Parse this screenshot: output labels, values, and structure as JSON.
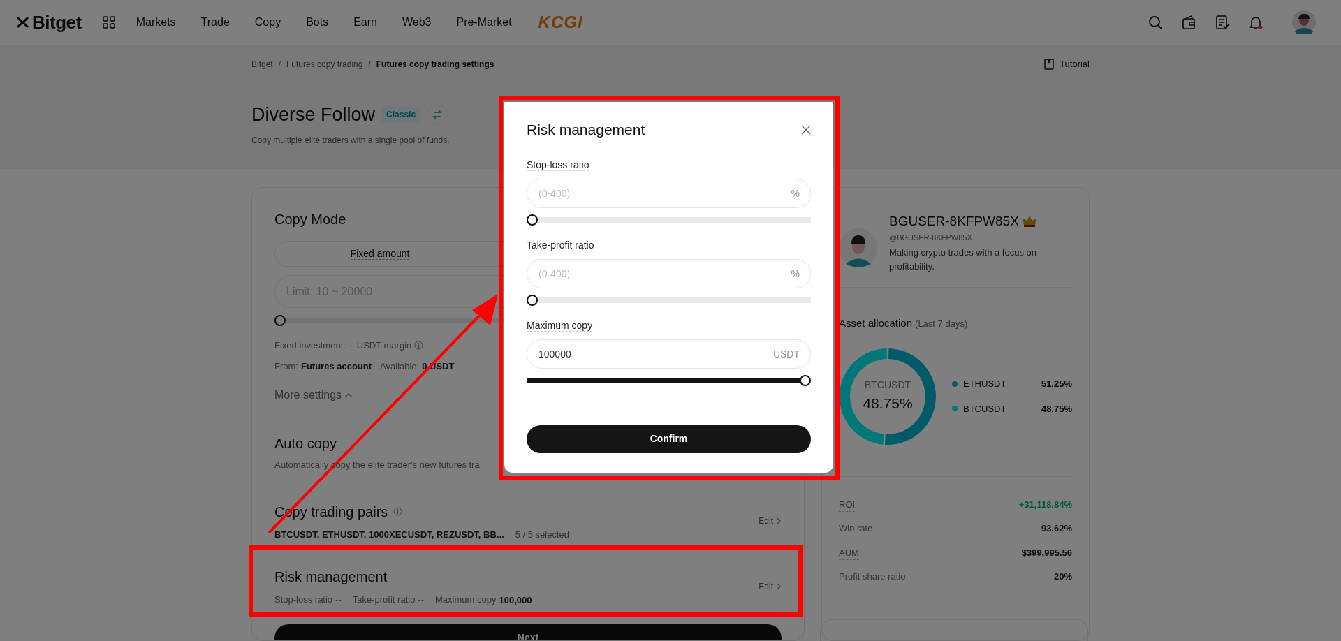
{
  "header": {
    "logo": "Bitget",
    "nav": [
      {
        "label": "Markets"
      },
      {
        "label": "Trade"
      },
      {
        "label": "Copy"
      },
      {
        "label": "Bots"
      },
      {
        "label": "Earn"
      },
      {
        "label": "Web3"
      },
      {
        "label": "Pre-Market"
      }
    ],
    "promo_logo": "KCGI",
    "notifications_unread": true
  },
  "breadcrumb": [
    {
      "label": "Bitget",
      "current": false
    },
    {
      "separator": "/",
      "label": "Futures copy trading",
      "current": false
    },
    {
      "separator": "/",
      "label": "Futures copy trading settings",
      "current": true
    }
  ],
  "tutorial": "Tutorial",
  "page": {
    "title": "Diverse Follow",
    "badge": "Classic",
    "subtitle": "Copy multiple elite traders with a single pool of funds."
  },
  "copy_mode": {
    "title": "Copy Mode",
    "tabs": [
      {
        "label": "Fixed amount"
      }
    ],
    "amount_field": {
      "placeholder": "Limit: 10 ~ 20000"
    },
    "amount_slider": {
      "level": 0
    },
    "fixed_investment": "Fixed investment: -- USDT margin",
    "from_label": "From:",
    "from_value": "Futures account",
    "available_label": "Available:",
    "available_value": "0 USDT",
    "more_settings": "More settings"
  },
  "auto_copy": {
    "title": "Auto copy",
    "description": "Automatically copy the elite trader's new futures tra"
  },
  "pairs": {
    "title": "Copy trading pairs",
    "list": "BTCUSDT, ETHUSDT, 1000XECUSDT, REZUSDT, BB...",
    "count": "5 / 5 selected",
    "edit": "Edit"
  },
  "risk": {
    "title": "Risk management",
    "items": [
      {
        "label": "Stop-loss ratio",
        "value": "--"
      },
      {
        "label": "Take-profit ratio",
        "value": "--"
      },
      {
        "label": "Maximum copy",
        "value": "100,000"
      }
    ],
    "edit": "Edit"
  },
  "next_button": "Next",
  "trader": {
    "name": "BGUSER-8KFPW85X",
    "handle": "@BGUSER-8KFPW85X",
    "bio": "Making crypto trades with a focus on profitability.",
    "allocation_title": "Asset allocation",
    "allocation_period": "(Last 7 days)",
    "center_label": "BTCUSDT",
    "center_value": "48.75%",
    "chart_data": {
      "type": "donut",
      "categories": [
        "ETHUSDT",
        "BTCUSDT"
      ],
      "values": [
        51.25,
        48.75
      ]
    },
    "legend": [
      {
        "value": "51.25%",
        "color": "#005a69"
      },
      {
        "value": "48.75%",
        "color": "#00787a"
      }
    ],
    "stats": [
      {
        "label": "ROI",
        "value": "+31,118.84%",
        "positive": true
      },
      {
        "label": "Win rate",
        "value": "93.62%",
        "positive": false
      },
      {
        "label": "AUM",
        "value": "$399,995.56",
        "positive": false
      },
      {
        "label": "Profit share ratio",
        "value": "20%",
        "positive": false
      }
    ]
  },
  "modal": {
    "title": "Risk management",
    "fields": [
      {
        "label": "Stop-loss ratio",
        "placeholder": "(0-400)",
        "unit": "%",
        "level": 0
      },
      {
        "label": "Take-profit ratio",
        "placeholder": "(0-400)",
        "unit": "%",
        "level": 0
      },
      {
        "label": "Maximum copy",
        "value": "100000",
        "unit": "USDT",
        "level": 1
      }
    ],
    "confirm": "Confirm"
  }
}
